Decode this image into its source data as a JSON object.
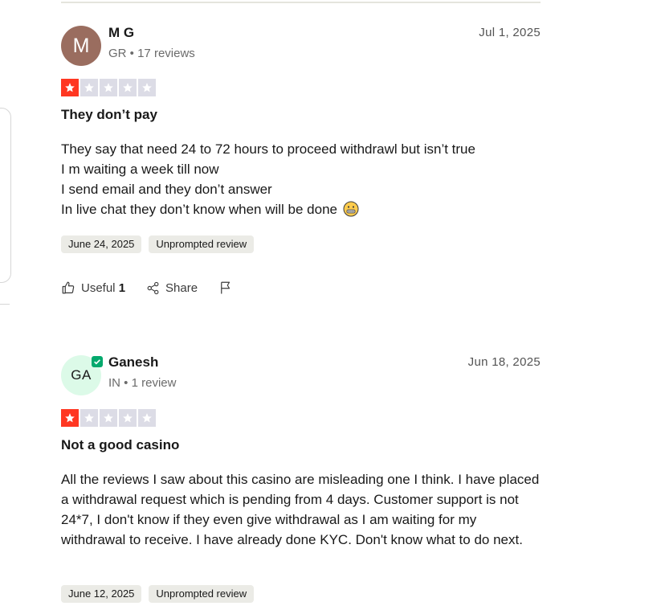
{
  "colors": {
    "star_red": "#ff3722",
    "star_empty": "#dcdce6",
    "verified_green": "#04a96d",
    "avatar_mg": "#9a6d5f",
    "avatar_ga": "#dcfae8",
    "tag_bg": "#ebebe6"
  },
  "reviews": [
    {
      "avatar_initials": "M",
      "author": "M G",
      "country": "GR",
      "review_count": "17 reviews",
      "date": "Jul 1, 2025",
      "rating": 1,
      "max_rating": 5,
      "title": "They don’t pay",
      "body_lines": [
        "They say that need 24 to 72 hours to proceed withdrawl but isn’t true",
        "I m waiting a week till now",
        "I send email and they don’t answer",
        "In live chat they don’t know when will be done"
      ],
      "emoji_icon": "grimacing-face-icon",
      "experience_date": "June 24, 2025",
      "review_type": "Unprompted review",
      "useful_label": "Useful",
      "useful_count": "1",
      "share_label": "Share"
    },
    {
      "avatar_initials": "GA",
      "author": "Ganesh",
      "country": "IN",
      "review_count": "1 review",
      "date": "Jun 18, 2025",
      "rating": 1,
      "max_rating": 5,
      "verified": true,
      "title": "Not a good casino",
      "body": "All the reviews I saw about this casino are misleading one I think. I have placed a withdrawal request which is pending from 4 days. Customer support is not 24*7, I don't know if they even give withdrawal as I am waiting for my withdrawal to receive. I have already done KYC. Don't know what to do next.",
      "experience_date": "June 12, 2025",
      "review_type": "Unprompted review"
    }
  ]
}
